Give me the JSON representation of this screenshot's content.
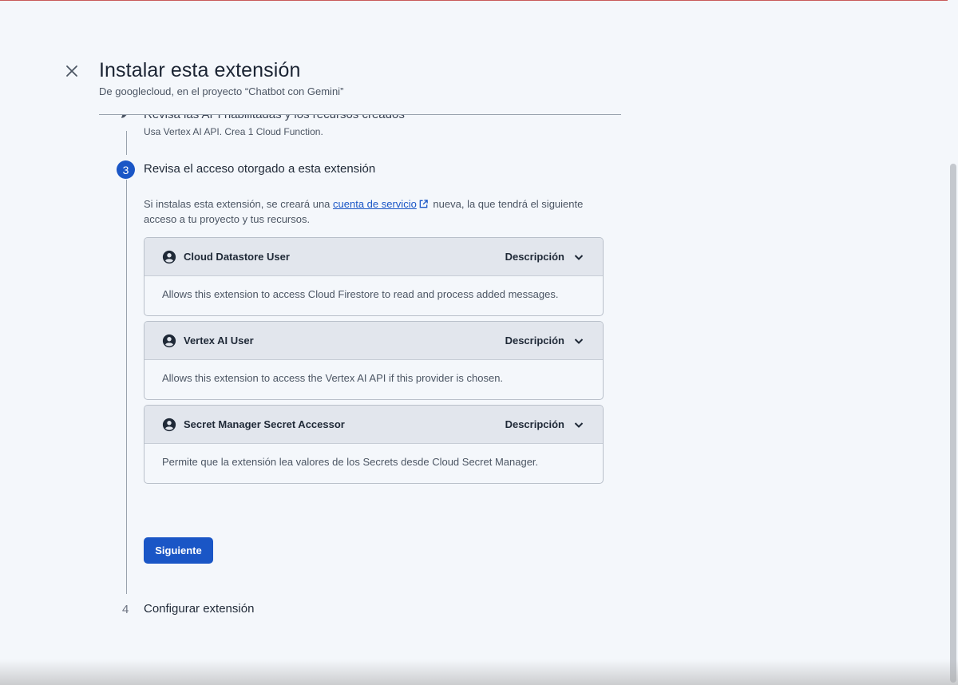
{
  "header": {
    "title": "Instalar esta extensión",
    "subtitle": "De googlecloud, en el proyecto “Chatbot con Gemini”"
  },
  "steps": {
    "step2": {
      "title": "Revisa las API habilitadas y los recursos creados",
      "description": "Usa Vertex AI API. Crea 1 Cloud Function."
    },
    "step3": {
      "number": "3",
      "title": "Revisa el acceso otorgado a esta extensión",
      "intro_before": "Si instalas esta extensión, se creará una ",
      "intro_link": "cuenta de servicio",
      "intro_after": " nueva, la que tendrá el siguiente acceso a tu proyecto y tus recursos.",
      "roles": [
        {
          "name": "Cloud Datastore User",
          "desc_label": "Descripción",
          "description": "Allows this extension to access Cloud Firestore to read and process added messages."
        },
        {
          "name": "Vertex AI User",
          "desc_label": "Descripción",
          "description": "Allows this extension to access the Vertex AI API if this provider is chosen."
        },
        {
          "name": "Secret Manager Secret Accessor",
          "desc_label": "Descripción",
          "description": "Permite que la extensión lea valores de los Secrets desde Cloud Secret Manager."
        }
      ],
      "next_button": "Siguiente"
    },
    "step4": {
      "number": "4",
      "title": "Configurar extensión"
    }
  },
  "colors": {
    "accent": "#1a56c6",
    "background": "#f4f7fb",
    "role_header": "#e2e6ed"
  },
  "icons": {
    "close": "close-icon",
    "edit": "pencil-icon",
    "external_link": "external-link-icon",
    "role": "account-circle-icon",
    "expand": "chevron-down-icon"
  }
}
